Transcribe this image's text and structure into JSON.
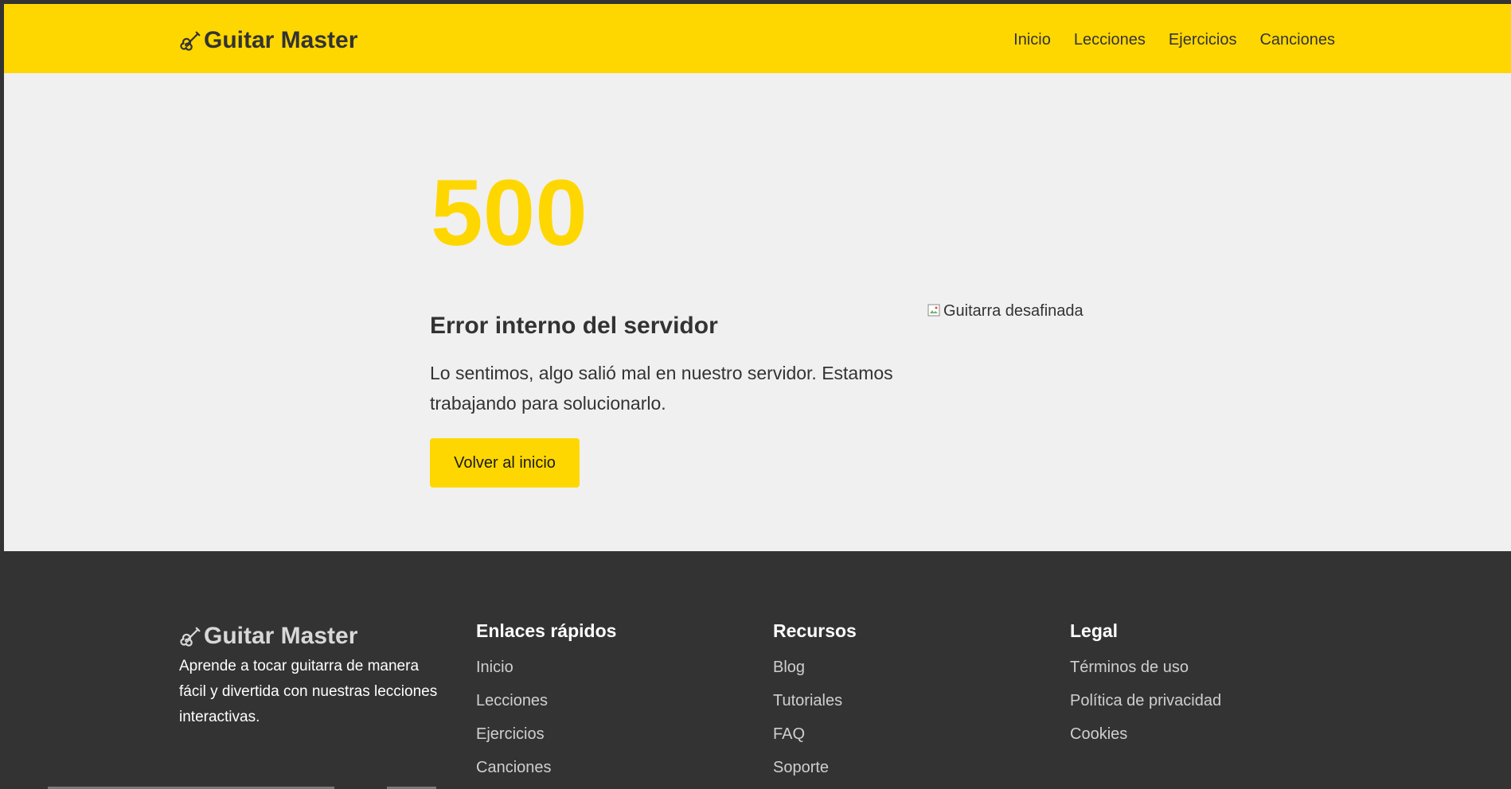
{
  "header": {
    "brand": "Guitar Master",
    "brand_icon": "guitar-icon",
    "accent_color": "#ffd700",
    "nav": [
      "Inicio",
      "Lecciones",
      "Ejercicios",
      "Canciones"
    ]
  },
  "main": {
    "code": "500",
    "title": "Error interno del servidor",
    "message": "Lo sentimos, algo salió mal en nuestro servidor. Estamos trabajando para solucionarlo.",
    "button": "Volver al inicio",
    "image_alt": "Guitarra desafinada",
    "image_icon": "broken-image-icon"
  },
  "footer": {
    "brand": "Guitar Master",
    "description": "Aprende a tocar guitarra de manera fácil y divertida con nuestras lecciones interactivas.",
    "quick_links": {
      "title": "Enlaces rápidos",
      "items": [
        "Inicio",
        "Lecciones",
        "Ejercicios",
        "Canciones"
      ]
    },
    "resources": {
      "title": "Recursos",
      "items": [
        "Blog",
        "Tutoriales",
        "FAQ",
        "Soporte"
      ]
    },
    "legal": {
      "title": "Legal",
      "items": [
        "Términos de uso",
        "Política de privacidad",
        "Cookies"
      ]
    },
    "background_color": "#333333"
  }
}
